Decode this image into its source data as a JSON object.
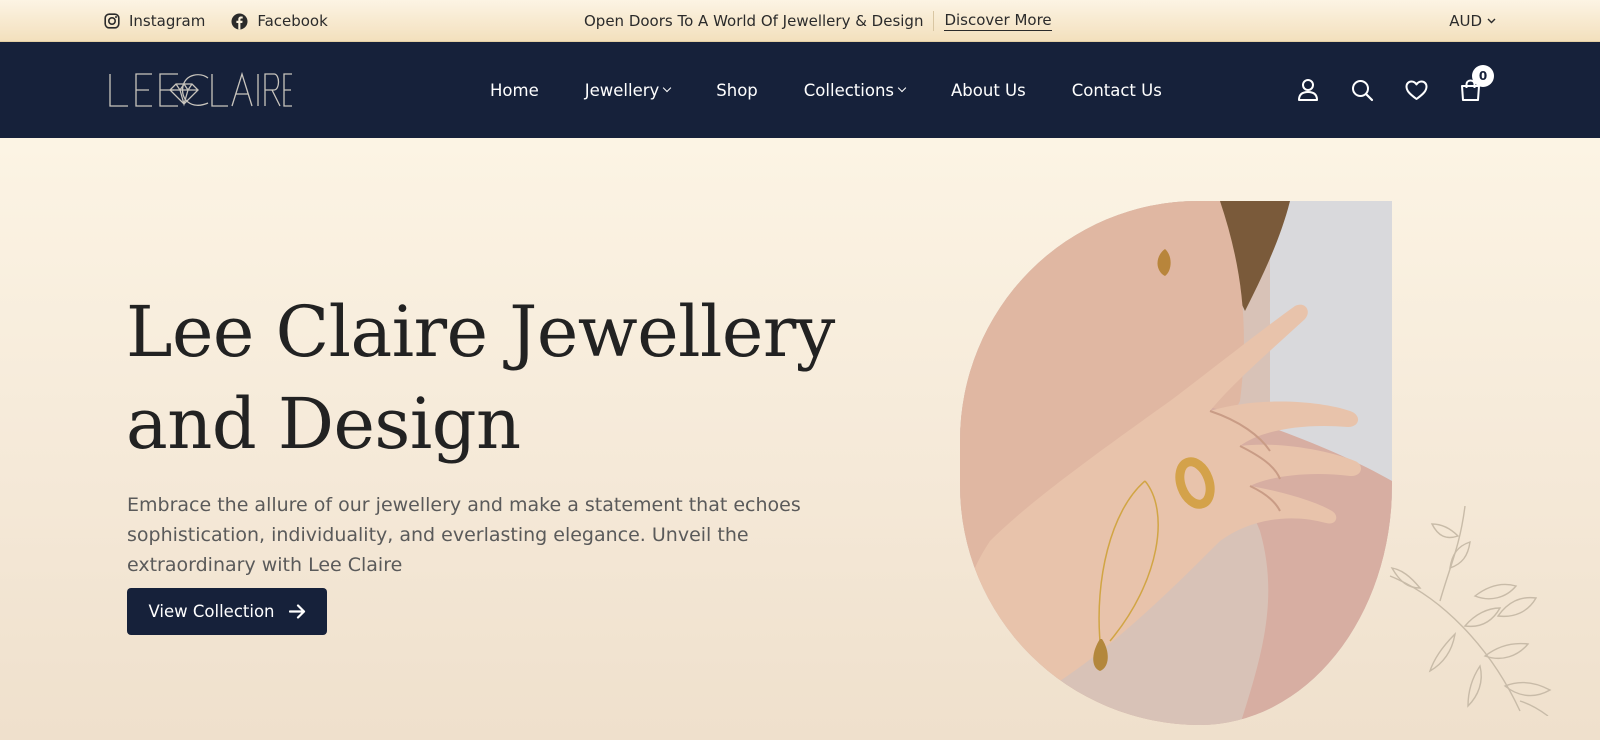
{
  "topbar": {
    "social": [
      {
        "label": "Instagram",
        "icon": "instagram-icon"
      },
      {
        "label": "Facebook",
        "icon": "facebook-icon"
      }
    ],
    "announcement": "Open Doors To A World Of Jewellery & Design",
    "announcement_link": "Discover More",
    "currency": "AUD"
  },
  "brand": {
    "logo_text": "LEECLAIRE"
  },
  "nav": {
    "items": [
      {
        "label": "Home"
      },
      {
        "label": "Jewellery"
      },
      {
        "label": "Shop"
      },
      {
        "label": "Collections"
      },
      {
        "label": "About Us"
      },
      {
        "label": "Contact Us"
      }
    ],
    "cart_count": "0"
  },
  "hero": {
    "title_line1": "Lee Claire Jewellery",
    "title_line2": "and Design",
    "description": "Embrace the allure of our jewellery and make a statement that echoes sophistication, individuality, and everlasting elegance. Unveil the extraordinary with Lee Claire",
    "cta_label": "View Collection"
  },
  "colors": {
    "navy": "#16213a",
    "cream": "#fcf4e4",
    "gold_bar": "#f3e0bd"
  }
}
